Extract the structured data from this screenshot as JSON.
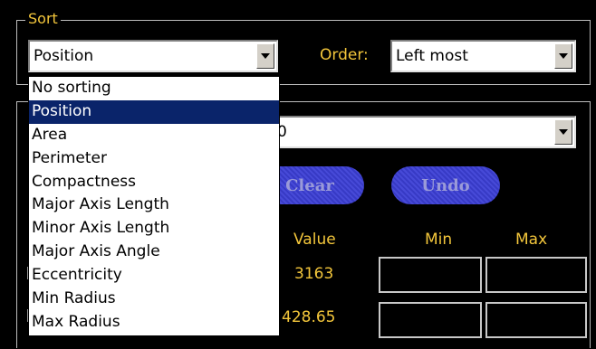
{
  "sort_group": {
    "title": "Sort",
    "sort_by": {
      "value": "Position"
    },
    "order_label": "Order:",
    "order": {
      "value": "Left most"
    }
  },
  "dropdown": {
    "options": [
      "No sorting",
      "Position",
      "Area",
      "Perimeter",
      "Compactness",
      "Major Axis Length",
      "Minor Axis Length",
      "Major Axis Angle",
      "Eccentricity",
      "Min Radius",
      "Max Radius"
    ],
    "selected_index": 1
  },
  "filter_group": {
    "combo_partial_text": "0",
    "clear_label": "Clear",
    "undo_label": "Undo",
    "headers": {
      "value": "Value",
      "min": "Min",
      "max": "Max"
    },
    "rows": [
      {
        "value": "3163",
        "min": "",
        "max": ""
      },
      {
        "value": "428.65",
        "min": "",
        "max": ""
      }
    ]
  },
  "colors": {
    "label_yellow": "#f3c63b",
    "selection_blue": "#0a246a",
    "button_blue": "#3c3fd6"
  }
}
